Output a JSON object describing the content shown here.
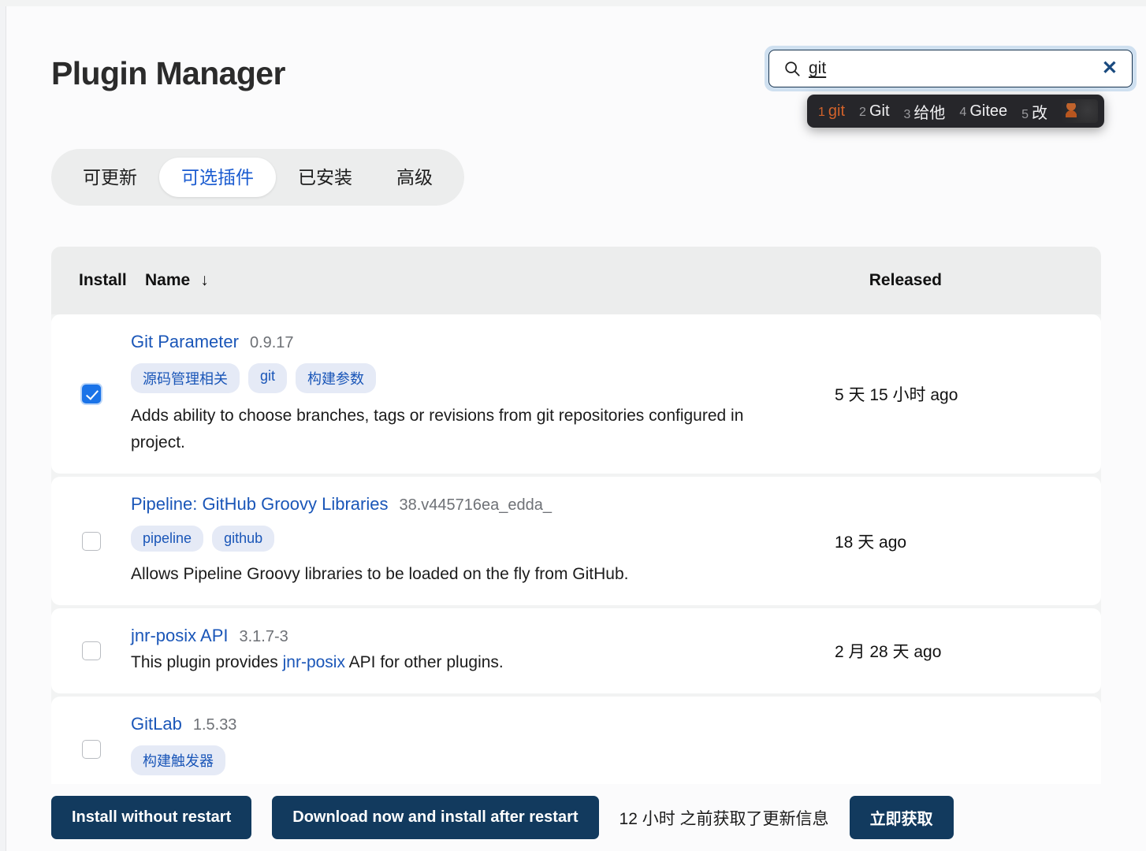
{
  "header": {
    "title": "Plugin Manager"
  },
  "search": {
    "icon": "search-icon",
    "value": "git",
    "placeholder": "",
    "clear_label": "✕"
  },
  "ime": {
    "candidates": [
      {
        "num": "1",
        "text": "git",
        "selected": true
      },
      {
        "num": "2",
        "text": "Git",
        "selected": false
      },
      {
        "num": "3",
        "text": "给他",
        "selected": false
      },
      {
        "num": "4",
        "text": "Gitee",
        "selected": false
      },
      {
        "num": "5",
        "text": "改",
        "selected": false
      }
    ],
    "logo": "ime-logo-icon"
  },
  "tabs": [
    {
      "label": "可更新",
      "active": false
    },
    {
      "label": "可选插件",
      "active": true
    },
    {
      "label": "已安装",
      "active": false
    },
    {
      "label": "高级",
      "active": false
    }
  ],
  "table": {
    "columns": {
      "install": "Install",
      "name": "Name",
      "sort_arrow": "↓",
      "released": "Released"
    },
    "rows": [
      {
        "checked": true,
        "name": "Git Parameter",
        "version": "0.9.17",
        "tags": [
          "源码管理相关",
          "git",
          "构建参数"
        ],
        "description_pre": "Adds ability to choose branches, tags or revisions from git repositories configured in project.",
        "description_link": "",
        "description_post": "",
        "released": "5 天 15 小时 ago"
      },
      {
        "checked": false,
        "name": "Pipeline: GitHub Groovy Libraries",
        "version": "38.v445716ea_edda_",
        "tags": [
          "pipeline",
          "github"
        ],
        "description_pre": "Allows Pipeline Groovy libraries to be loaded on the fly from GitHub.",
        "description_link": "",
        "description_post": "",
        "released": "18 天 ago"
      },
      {
        "checked": false,
        "name": "jnr-posix API",
        "version": "3.1.7-3",
        "tags": [],
        "description_pre": "This plugin provides ",
        "description_link": "jnr-posix",
        "description_post": " API for other plugins.",
        "released": "2 月 28 天 ago"
      },
      {
        "checked": false,
        "name": "GitLab",
        "version": "1.5.33",
        "tags": [
          "构建触发器"
        ],
        "description_pre": "",
        "description_link": "",
        "description_post": "",
        "released": ""
      }
    ]
  },
  "footer": {
    "install_without_restart": "Install without restart",
    "download_install_after_restart": "Download now and install after restart",
    "update_info": "12 小时 之前获取了更新信息",
    "fetch_now": "立即获取"
  },
  "colors": {
    "accent_blue": "#1a56b8",
    "tab_active_text": "#1a5bd0",
    "button_navy": "#123a5e",
    "checkbox_blue": "#1a73e8",
    "ime_selected": "#d2622a",
    "tag_bg": "#e5eaf6"
  }
}
